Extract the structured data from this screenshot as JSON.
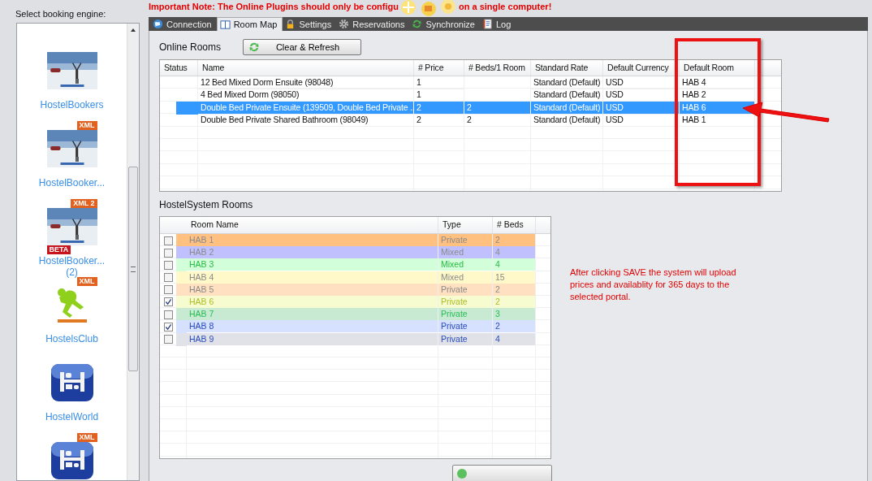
{
  "note": {
    "part1": "Important Note:  The Online Plugins should only be configu",
    "part2": "on a single computer!"
  },
  "engines": {
    "label": "Select booking engine:",
    "items": [
      {
        "label": "HostelBookers"
      },
      {
        "label": "HostelBooker...",
        "badges": [
          {
            "kind": "xml",
            "text": "XML"
          }
        ]
      },
      {
        "label": "HostelBooker...",
        "sublabel": "(2)",
        "badges": [
          {
            "kind": "xml",
            "text": "XML 2"
          },
          {
            "kind": "beta",
            "text": "BETA"
          }
        ]
      },
      {
        "kind": "club",
        "label": "HostelsClub",
        "badges": [
          {
            "kind": "xml",
            "text": "XML"
          }
        ]
      },
      {
        "kind": "world",
        "label": "HostelWorld"
      },
      {
        "kind": "world",
        "badges": [
          {
            "kind": "xml",
            "text": "XML"
          }
        ]
      }
    ]
  },
  "tabs": [
    {
      "label": "Connection",
      "selected": false
    },
    {
      "label": "Room Map",
      "selected": true
    },
    {
      "label": "Settings",
      "selected": false
    },
    {
      "label": "Reservations",
      "selected": false
    },
    {
      "label": "Synchronize",
      "selected": false
    },
    {
      "label": "Log",
      "selected": false
    }
  ],
  "online_rooms": {
    "title": "Online Rooms",
    "refresh_button": "Clear & Refresh",
    "columns": [
      "Status",
      "Name",
      "# Price",
      "# Beds/1 Room",
      "Standard Rate",
      "Default Currency",
      "Default Room"
    ],
    "rows": [
      {
        "name": "12 Bed Mixed Dorm Ensuite (98048)",
        "price": "1",
        "rate": "Standard (Default)",
        "currency": "USD",
        "room": "HAB 4",
        "selected": false
      },
      {
        "name": "4 Bed Mixed Dorm (98050)",
        "price": "1",
        "rate": "Standard (Default)",
        "currency": "USD",
        "room": "HAB 2",
        "selected": false
      },
      {
        "name": "Double Bed Private Ensuite (139509, Double Bed Private ...",
        "price": "2",
        "beds": "2",
        "rate": "Standard (Default)",
        "currency": "USD",
        "room": "HAB 6",
        "selected": true
      },
      {
        "name": "Double Bed Private Shared Bathroom (98049)",
        "price": "2",
        "beds": "2",
        "rate": "Standard (Default)",
        "currency": "USD",
        "room": "HAB 1",
        "selected": false
      }
    ]
  },
  "system_rooms": {
    "title": "HostelSystem Rooms",
    "columns": [
      "Room Name",
      "Type",
      "# Beds"
    ],
    "rows": [
      {
        "name": "HAB 1",
        "type": "Private",
        "beds": "2",
        "checked": false,
        "dimmed": true,
        "color": "#ffc080"
      },
      {
        "name": "HAB 2",
        "type": "Mixed",
        "beds": "4",
        "checked": false,
        "dimmed": true,
        "color": "#c0c0ff"
      },
      {
        "name": "HAB 3",
        "type": "Mixed",
        "beds": "4",
        "checked": false,
        "dimmed": false,
        "color": "#d2ffda"
      },
      {
        "name": "HAB 4",
        "type": "Mixed",
        "beds": "15",
        "checked": false,
        "dimmed": true,
        "color": "#fff8c8"
      },
      {
        "name": "HAB 5",
        "type": "Private",
        "beds": "2",
        "checked": false,
        "dimmed": true,
        "color": "#ffe0c0"
      },
      {
        "name": "HAB 6",
        "type": "Private",
        "beds": "2",
        "checked": true,
        "dimmed": false,
        "color": "#f6fbd0"
      },
      {
        "name": "HAB 7",
        "type": "Private",
        "beds": "3",
        "checked": false,
        "dimmed": false,
        "color": "#c8ead2"
      },
      {
        "name": "HAB 8",
        "type": "Private",
        "beds": "2",
        "checked": true,
        "dimmed": false,
        "color": "#d6e0ff"
      },
      {
        "name": "HAB 9",
        "type": "Private",
        "beds": "4",
        "checked": false,
        "dimmed": false,
        "color": "#e0e2e8"
      }
    ]
  },
  "save_note": "After clicking SAVE the system will upload prices and availablity for 365 days to the selected portal."
}
